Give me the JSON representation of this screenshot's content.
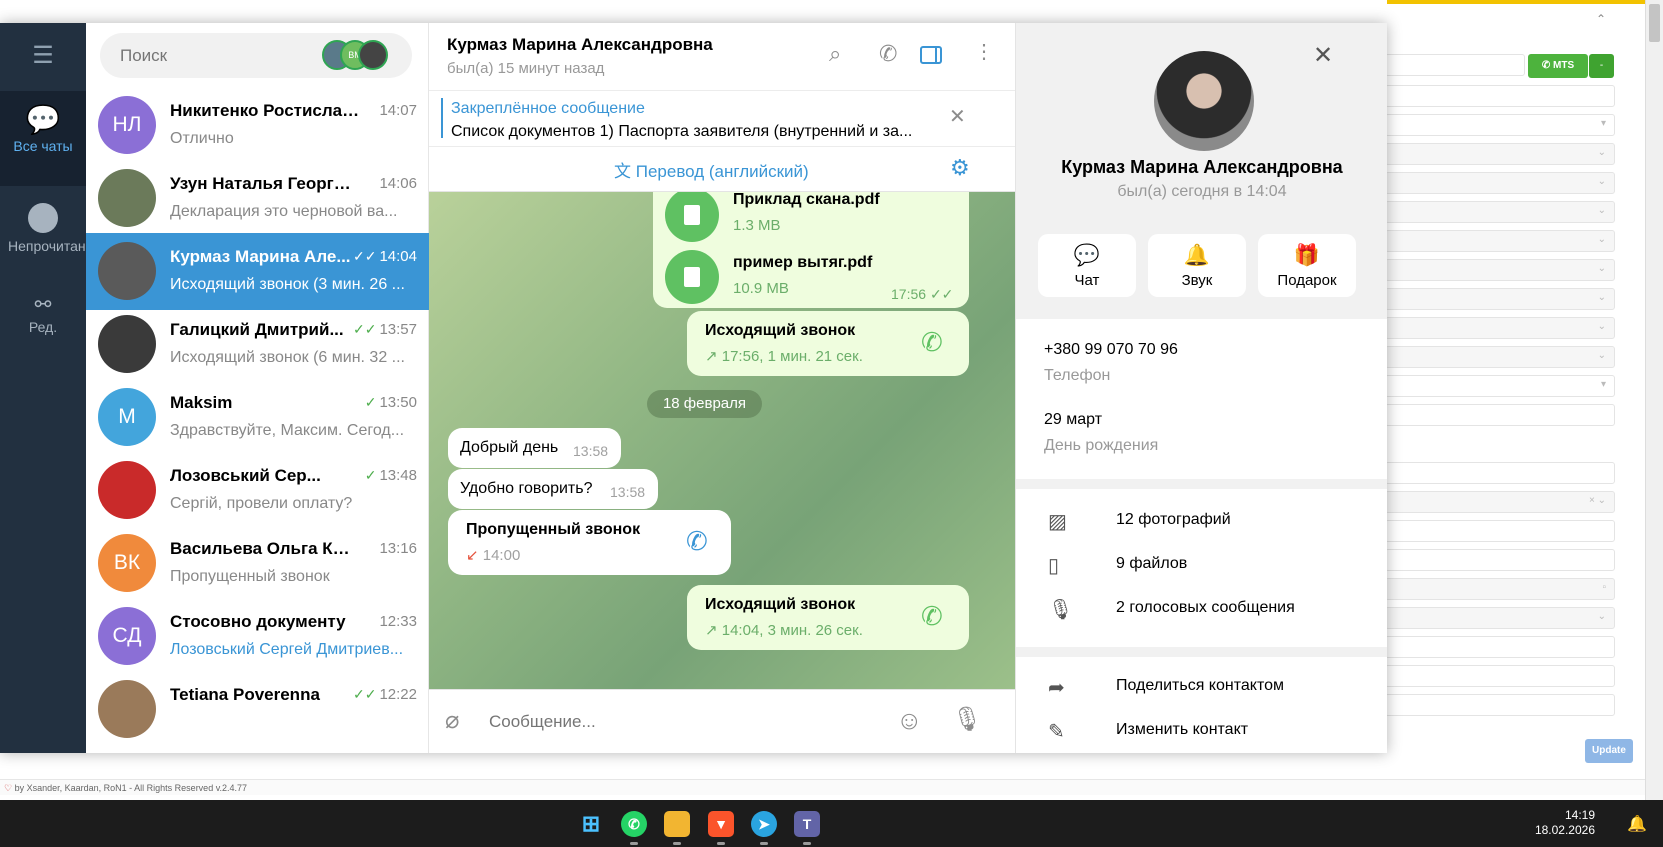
{
  "background_app": {
    "button_label": "MTS",
    "update_label": "Update",
    "footer": "by Xsander, Kaardan, RoN1 - All Rights Reserved v.2.4.77"
  },
  "window": {
    "minimize": "—",
    "maximize": "☐",
    "close": "✕"
  },
  "rail": {
    "all_chats": "Все чаты",
    "unread": "Непрочитано",
    "edit": "Ред."
  },
  "search": {
    "placeholder": "Поиск",
    "stack_label": "ВМ"
  },
  "chats": [
    {
      "initials": "НЛ",
      "name": "Никитенко Ростислав ...",
      "time": "14:07",
      "message": "Отлично",
      "color": "#8b6fd6",
      "check": ""
    },
    {
      "initials": "",
      "name": "Узун Наталья Георгиев...",
      "time": "14:06",
      "message": "Декларация это черновой ва...",
      "color": "#6b7a5a",
      "check": ""
    },
    {
      "initials": "",
      "name": "Курмаз Марина Але...",
      "time": "14:04",
      "message": "Исходящий звонок (3 мин. 26 ...",
      "color": "#5a5a5a",
      "check": "✓✓"
    },
    {
      "initials": "",
      "name": "Галицкий Дмитрий...",
      "time": "13:57",
      "message": "Исходящий звонок (6 мин. 32 ...",
      "color": "#3a3a3a",
      "check": "✓✓"
    },
    {
      "initials": "M",
      "name": "Maksim",
      "time": "13:50",
      "message": "Здравствуйте, Максим. Сегод...",
      "color": "#43a5dc",
      "check": "✓"
    },
    {
      "initials": "",
      "name": "Лозовський Сер...",
      "time": "13:48",
      "message": "Сергій, провели оплату?",
      "color": "#c92a2a",
      "check": "✓"
    },
    {
      "initials": "ВК",
      "name": "Васильева Ольга Конс...",
      "time": "13:16",
      "message": "Пропущенный звонок",
      "color": "#f08a3c",
      "check": ""
    },
    {
      "initials": "СД",
      "name": "Стосовно документу",
      "time": "12:33",
      "message": "Лозовський Сергей Дмитриев...",
      "color": "#8b6fd6",
      "check": ""
    },
    {
      "initials": "",
      "name": "Tetiana Poverenna",
      "time": "12:22",
      "message": "",
      "color": "#9a7a5a",
      "check": "✓✓"
    }
  ],
  "chat": {
    "name": "Курмаз Марина Александровна",
    "status": "был(а) 15 минут назад",
    "pinned_title": "Закреплённое сообщение",
    "pinned_text": "Список документов   1) Паспорта заявителя (внутренний и за...",
    "translate": "Перевод (английский)",
    "composer_placeholder": "Сообщение...",
    "date_pill": "18 февраля",
    "files": [
      {
        "name": "Приклад скана.pdf",
        "size": "1.3 MB"
      },
      {
        "name": "пример вытяг.pdf",
        "size": "10.9 MB",
        "time": "17:56"
      }
    ],
    "call1": {
      "title": "Исходящий звонок",
      "sub": "17:56, 1 мин. 21 сек."
    },
    "msg1": {
      "text": "Добрый день",
      "time": "13:58"
    },
    "msg2": {
      "text": "Удобно говорить?",
      "time": "13:58"
    },
    "missed": {
      "title": "Пропущенный звонок",
      "sub": "14:00"
    },
    "call2": {
      "title": "Исходящий звонок",
      "sub": "14:04, 3 мин. 26 сек."
    }
  },
  "info": {
    "name": "Курмаз Марина Александровна",
    "status": "был(а) сегодня в 14:04",
    "actions": [
      "Чат",
      "Звук",
      "Подарок"
    ],
    "phone": "+380 99 070 70 96",
    "phone_label": "Телефон",
    "birthday": "29 март",
    "birthday_label": "День рождения",
    "media": [
      "12 фотографий",
      "9 файлов",
      "2 голосовых сообщения"
    ],
    "share": "Поделиться контактом",
    "edit": "Изменить контакт"
  },
  "taskbar": {
    "time": "14:19",
    "date": "18.02.2026"
  },
  "colors": {
    "accent": "#3a95d5",
    "rail": "#223040",
    "out_bubble": "#effdde",
    "green": "#5fc162"
  }
}
